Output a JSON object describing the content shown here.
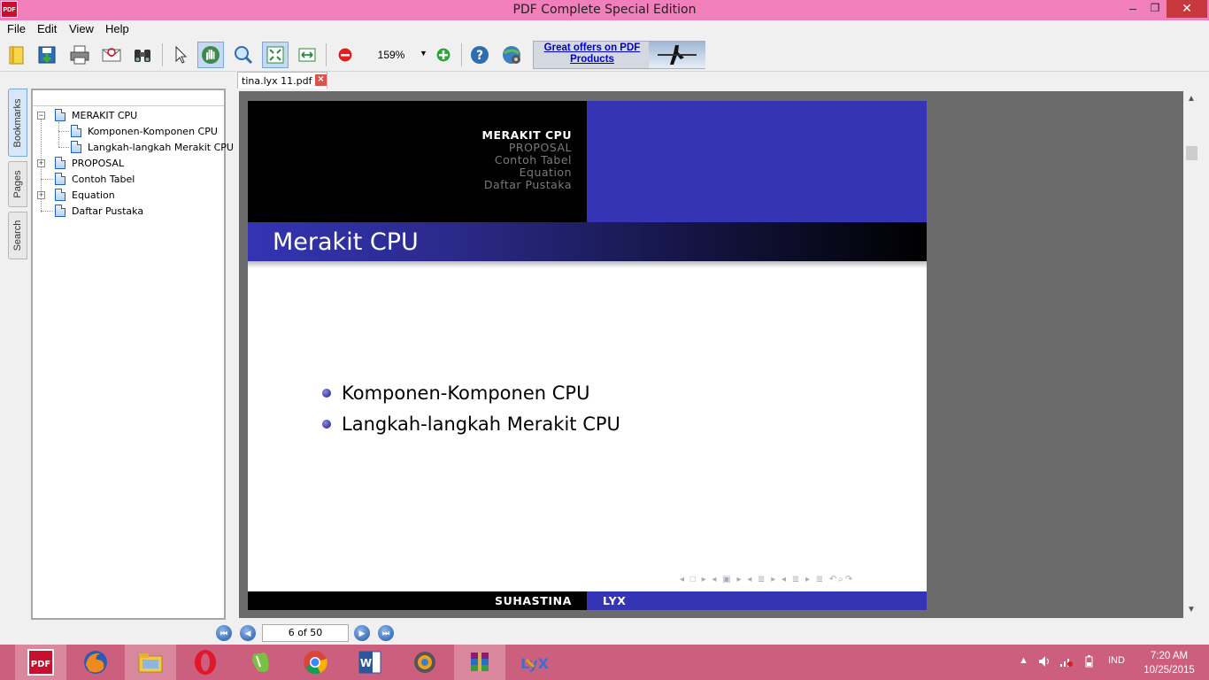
{
  "window": {
    "title": "PDF Complete Special Edition",
    "app_icon_text": "PDF",
    "controls": {
      "minimize": "–",
      "maximize": "❐",
      "close": "✕"
    }
  },
  "menu": [
    {
      "label": "File"
    },
    {
      "label": "Edit"
    },
    {
      "label": "View"
    },
    {
      "label": "Help"
    }
  ],
  "toolbar": {
    "zoom_value": "159%",
    "zoom_arrow": "▼",
    "ad_text": "Great offers on PDF Products"
  },
  "side_tabs": [
    {
      "label": "Bookmarks",
      "active": true
    },
    {
      "label": "Pages",
      "active": false
    },
    {
      "label": "Search",
      "active": false
    }
  ],
  "bookmarks": [
    {
      "label": "MERAKIT CPU",
      "level": 0,
      "expander": "−"
    },
    {
      "label": "Komponen-Komponen CPU",
      "level": 1,
      "expander": ""
    },
    {
      "label": "Langkah-langkah Merakit CPU",
      "level": 1,
      "expander": ""
    },
    {
      "label": "PROPOSAL",
      "level": 0,
      "expander": "+"
    },
    {
      "label": "Contoh Tabel",
      "level": 0,
      "expander": ""
    },
    {
      "label": "Equation",
      "level": 0,
      "expander": "+"
    },
    {
      "label": "Daftar Pustaka",
      "level": 0,
      "expander": ""
    }
  ],
  "document_tab": {
    "label": "tina.lyx 11.pdf",
    "close": "×"
  },
  "slide": {
    "nav_sections": [
      "MERAKIT CPU",
      "PROPOSAL",
      "Contoh Tabel",
      "Equation",
      "Daftar Pustaka"
    ],
    "frame_title": "Merakit CPU",
    "bullets": [
      "Komponen-Komponen CPU",
      "Langkah-langkah Merakit CPU"
    ],
    "beamer_nav": "◂ □ ▸  ◂ ▣ ▸  ◂ ≣ ▸  ◂ ≣ ▸   ≣   ↶⌕↷",
    "footer_left": "SUHASTINA",
    "footer_right": "LYX"
  },
  "page_nav": {
    "first": "⏮",
    "prev": "◀",
    "page_text": "6 of 50",
    "next": "▶",
    "last": "⏭"
  },
  "taskbar": {
    "apps": [
      "PDF Complete",
      "Firefox",
      "File Explorer",
      "Opera",
      "Evernote",
      "Chrome",
      "Word",
      "Control Panel",
      "WinRAR",
      "LyX"
    ],
    "tray_lang": "IND",
    "time": "7:20 AM",
    "date": "10/25/2015"
  }
}
